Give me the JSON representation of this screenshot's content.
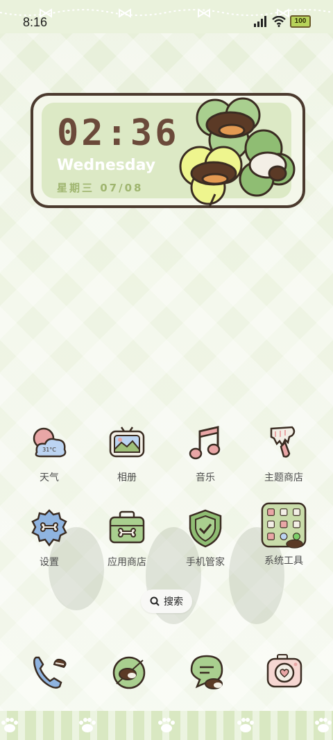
{
  "status_bar": {
    "time": "8:16",
    "battery": "100"
  },
  "clock_widget": {
    "time": "02:36",
    "weekday": "Wednesday",
    "date_cn": "星期三",
    "date": "07/08"
  },
  "apps": [
    {
      "label": "天气",
      "icon": "weather-icon",
      "badge": "31°C"
    },
    {
      "label": "相册",
      "icon": "gallery-icon"
    },
    {
      "label": "音乐",
      "icon": "music-icon"
    },
    {
      "label": "主题商店",
      "icon": "theme-store-icon"
    },
    {
      "label": "设置",
      "icon": "settings-icon"
    },
    {
      "label": "应用商店",
      "icon": "app-store-icon"
    },
    {
      "label": "手机管家",
      "icon": "phone-manager-icon"
    },
    {
      "label": "系统工具",
      "icon": "system-tools-folder-icon"
    }
  ],
  "search": {
    "label": "搜索"
  },
  "dock": [
    {
      "icon": "phone-icon"
    },
    {
      "icon": "browser-icon"
    },
    {
      "icon": "messages-icon"
    },
    {
      "icon": "camera-icon"
    }
  ],
  "colors": {
    "accent_green": "#dce9c5",
    "brown": "#4b3a2e",
    "pink": "#e9a6a6",
    "blue": "#8fb4e0"
  }
}
